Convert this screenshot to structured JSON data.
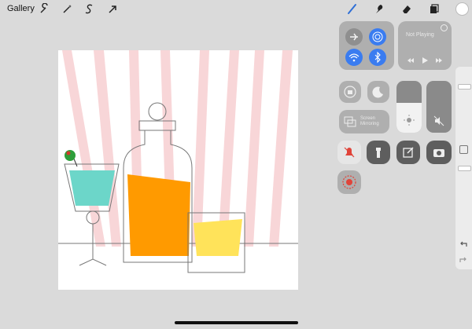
{
  "toolbar": {
    "gallery_label": "Gallery",
    "left_tools": [
      "wrench-icon",
      "magic-wand-icon",
      "selection-s-icon",
      "transform-arrow-icon"
    ],
    "right_tools": [
      "brush-icon",
      "smudge-icon",
      "eraser-icon",
      "layers-icon",
      "color-icon"
    ],
    "accent_color": "#2f6fd6"
  },
  "control_center": {
    "connectivity": [
      "airplane-mode-icon",
      "airdrop-icon",
      "wifi-icon",
      "bluetooth-icon"
    ],
    "media": {
      "status": "Not Playing",
      "controls": [
        "previous-icon",
        "play-icon",
        "next-icon"
      ]
    },
    "rotation_lock": "rotation-lock-icon",
    "do_not_disturb": "moon-icon",
    "screen_mirroring": {
      "line1": "Screen",
      "line2": "Mirroring"
    },
    "brightness_icon": "sun-icon",
    "mute_icon": "speaker-mute-icon",
    "row3": [
      "bell-mute-icon",
      "flashlight-icon",
      "notes-icon",
      "camera-icon"
    ],
    "record_icon": "screen-record-icon",
    "brightness_level": 0.58,
    "volume_level": 0.0
  },
  "sidebar": {
    "undo_icon": "undo-icon",
    "redo_icon": "redo-icon",
    "modify_button": "square-modify-icon"
  },
  "artwork": {
    "colors": {
      "stripes": "#f8d2d4",
      "glass_liquid": "#6cd6c9",
      "olive": "#2e9e3a",
      "whisky": "#ff9a00",
      "tumbler_liquid": "#ffe35a",
      "line": "#777777"
    }
  }
}
